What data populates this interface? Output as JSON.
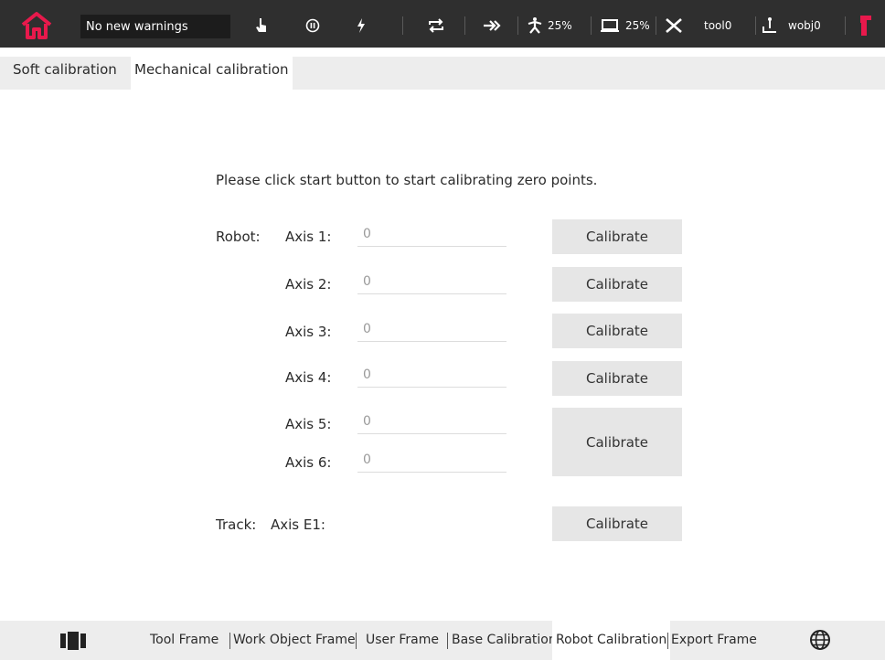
{
  "topbar": {
    "warning_text": "No new warnings",
    "speed_percent": "25%",
    "display_percent": "25%",
    "tool": "tool0",
    "wobj": "wobj0"
  },
  "tabs": [
    {
      "label": "Soft calibration"
    },
    {
      "label": "Mechanical calibration"
    }
  ],
  "main": {
    "instruction": "Please click start button to start calibrating zero points.",
    "robot_label": "Robot:",
    "track_label": "Track:",
    "axes": [
      {
        "label": "Axis 1:",
        "value": "0"
      },
      {
        "label": "Axis 2:",
        "value": "0"
      },
      {
        "label": "Axis 3:",
        "value": "0"
      },
      {
        "label": "Axis 4:",
        "value": "0"
      },
      {
        "label": "Axis 5:",
        "value": "0"
      },
      {
        "label": "Axis 6:",
        "value": "0"
      }
    ],
    "track_axis_label": "Axis E1:",
    "calibrate_label": "Calibrate"
  },
  "bottom_nav": [
    {
      "label": "Tool Frame"
    },
    {
      "label": "Work Object Frame"
    },
    {
      "label": "User Frame"
    },
    {
      "label": "Base Calibration"
    },
    {
      "label": "Robot Calibration"
    },
    {
      "label": "Export Frame"
    }
  ],
  "colors": {
    "accent": "#e8194c",
    "topbar": "#2f2f2f",
    "panel": "#ededed"
  }
}
